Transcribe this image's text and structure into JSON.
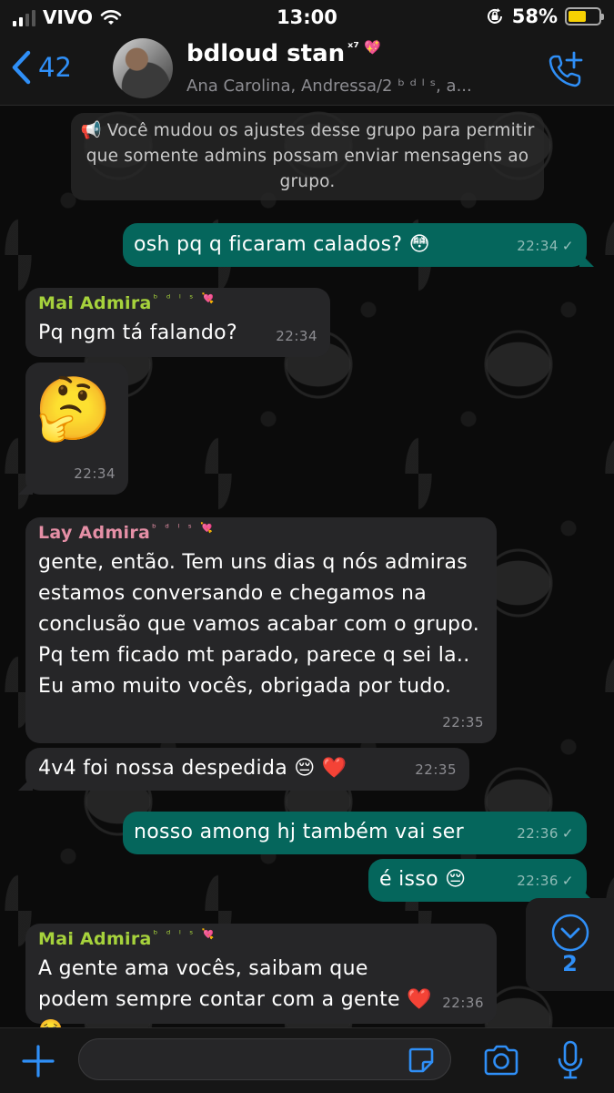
{
  "status_bar": {
    "carrier": "VIVO",
    "time": "13:00",
    "battery": "58%",
    "battery_level": 0.58
  },
  "header": {
    "back_count": "42",
    "group_name": "bdloud stan",
    "group_name_suffix": "ˣ⁷ 💖",
    "members": "Ana Carolina, Andressa/2 ᵇ ᵈ ˡ ˢ, a..."
  },
  "system_notice": "📢 Você mudou os ajustes desse grupo para permitir que somente admins possam enviar mensagens ao grupo.",
  "messages": [
    {
      "direction": "out",
      "text": "osh pq q ficaram calados? 😳",
      "time": "22:34",
      "status": "✓"
    },
    {
      "direction": "in",
      "sender": "Mai Admira",
      "sender_suffix": "ᵇ ᵈ ˡ ˢ 💘",
      "text": "Pq ngm tá falando?",
      "time": "22:34"
    },
    {
      "direction": "in",
      "text": "🤔",
      "time": "22:34"
    },
    {
      "direction": "in",
      "sender": "Lay Admira",
      "sender_suffix": "ᵇ ᵈ ˡ ˢ 💘",
      "text": "gente, então. Tem uns dias q nós admiras estamos conversando e chegamos na conclusão que vamos acabar com o grupo. Pq tem ficado mt parado, parece q sei la.. Eu amo muito vocês, obrigada por tudo.",
      "time": "22:35"
    },
    {
      "direction": "in",
      "text": "4v4 foi nossa despedida 😔 ❤️",
      "time": "22:35"
    },
    {
      "direction": "out",
      "text": "nosso among hj também vai ser",
      "time": "22:36",
      "status": "✓"
    },
    {
      "direction": "out",
      "text": "é isso 😔",
      "time": "22:36",
      "status": "✓"
    },
    {
      "direction": "in",
      "sender": "Mai Admira",
      "sender_suffix": "ᵇ ᵈ ˡ ˢ 💘",
      "text": "A gente ama vocês, saibam que podem sempre contar com a gente ❤️ 🥺",
      "time": "22:36"
    }
  ],
  "scroll_down": {
    "unread_count": "2"
  },
  "input": {
    "value": "",
    "placeholder": ""
  },
  "colors": {
    "accent": "#2f8ff7",
    "outgoing_bubble": "#05665c",
    "incoming_bubble": "#262628",
    "sender_mai": "#a6d23c",
    "sender_lay": "#e58fa6"
  },
  "icons": [
    "wifi-icon",
    "screen-rotation-lock-icon",
    "battery-icon",
    "back-chevron-icon",
    "call-add-icon",
    "megaphone-icon",
    "scroll-down-icon",
    "plus-icon",
    "sticker-icon",
    "camera-icon",
    "mic-icon"
  ]
}
